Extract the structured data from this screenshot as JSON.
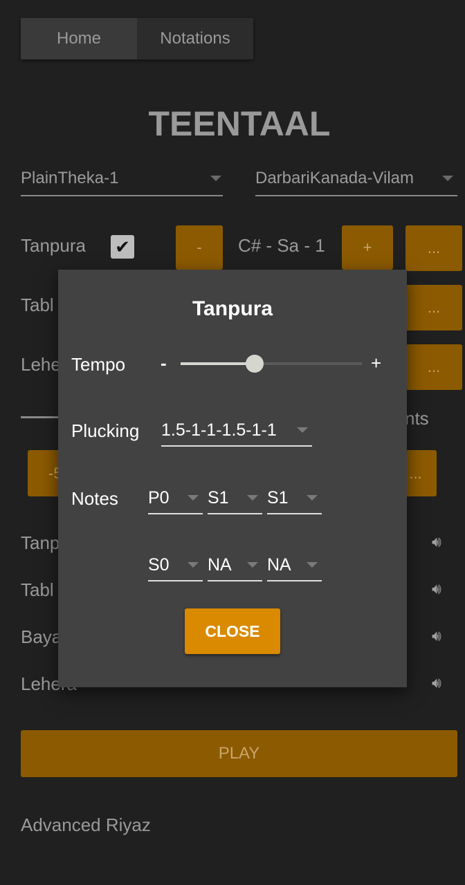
{
  "tabs": {
    "home": "Home",
    "notations": "Notations"
  },
  "page_title": "TEENTAAL",
  "theka_select": "PlainTheka-1",
  "raga_select": "DarbariKanada-Vilam",
  "rows": {
    "tanpura_label": "Tanpura",
    "tanpura_checked": true,
    "minus": "-",
    "pitch": "C# - Sa - 1",
    "plus": "+",
    "more": "...",
    "tabla_partial": "Tabl",
    "lehera_partial": "Lehe",
    "right_partial": "nts",
    "minus5_partial": "-5"
  },
  "volumes": [
    {
      "label": "Tanp"
    },
    {
      "label": "Tabl"
    },
    {
      "label": "Baya"
    },
    {
      "label": "Lehera"
    }
  ],
  "play": "PLAY",
  "advanced": "Advanced Riyaz",
  "dialog": {
    "title": "Tanpura",
    "tempo_label": "Tempo",
    "tempo_minus": "-",
    "tempo_plus": "+",
    "tempo_value_percent": 41,
    "plucking_label": "Plucking",
    "plucking_value": "1.5-1-1-1.5-1-1",
    "notes_label": "Notes",
    "notes": [
      "P0",
      "S1",
      "S1",
      "S0",
      "NA",
      "NA"
    ],
    "close": "CLOSE"
  },
  "colors": {
    "accent": "#d98a00",
    "dialog_bg": "#424242"
  }
}
